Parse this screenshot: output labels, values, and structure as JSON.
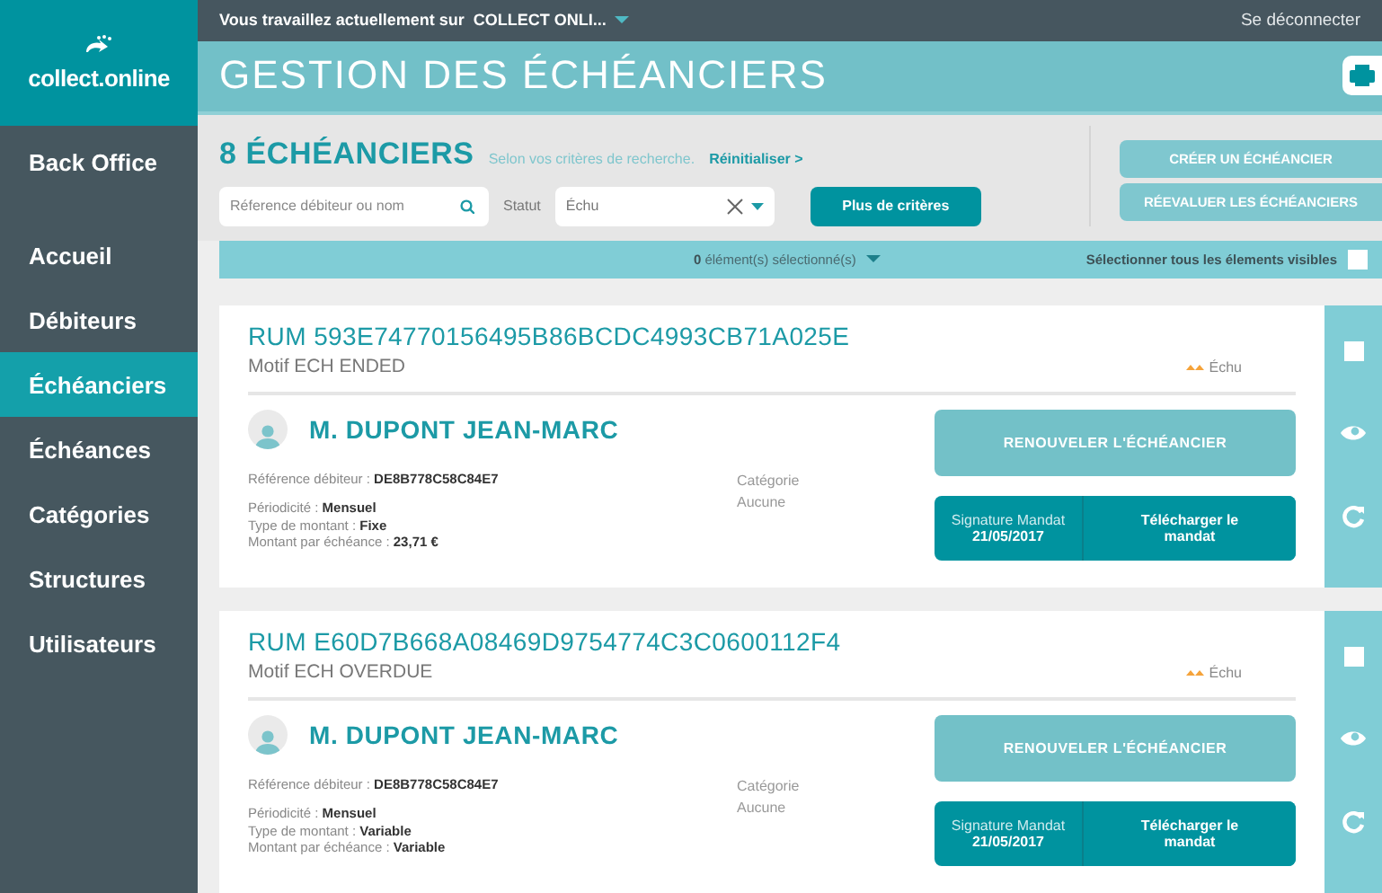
{
  "top_bar": {
    "workspace_label": "Vous travaillez actuellement sur",
    "workspace": "COLLECT ONLI...",
    "logout": "Se déconnecter"
  },
  "logo": {
    "text": "collect.online"
  },
  "sidebar": {
    "items": [
      {
        "label": "Back Office",
        "kind": "heading",
        "selected": false
      },
      {
        "label": "Accueil",
        "kind": "link",
        "selected": false
      },
      {
        "label": "Débiteurs",
        "kind": "link",
        "selected": false
      },
      {
        "label": "Échéanciers",
        "kind": "link",
        "selected": true
      },
      {
        "label": "Échéances",
        "kind": "link",
        "selected": false
      },
      {
        "label": "Catégories",
        "kind": "link",
        "selected": false
      },
      {
        "label": "Structures",
        "kind": "link",
        "selected": false
      },
      {
        "label": "Utilisateurs",
        "kind": "link",
        "selected": false
      }
    ]
  },
  "header": {
    "title": "GESTION DES ÉCHÉANCIERS"
  },
  "filters": {
    "count_title": "8 ÉCHÉANCIERS",
    "criteria_note": "Selon vos critères de recherche.",
    "reset_link": "Réinitialiser >",
    "search": {
      "placeholder": "Réference débiteur ou nom"
    },
    "status_label": "Statut",
    "status_value": "Échu",
    "more_button": "Plus de critères",
    "actions": [
      "CRÉER UN ÉCHÉANCIER",
      "RÉEVALUER LES ÉCHÉANCIERS"
    ]
  },
  "selection_bar": {
    "count": "0",
    "count_text": "élément(s) sélectionné(s)",
    "select_all_label": "Sélectionner tous les élements visibles",
    "checked": false
  },
  "schedules": [
    {
      "rum": "RUM 593E74770156495B86BCDC4993CB71A025E",
      "motif": "Motif ECH ENDED",
      "status": "Échu",
      "debtor": "M. DUPONT JEAN-MARC",
      "reference_label": "Référence débiteur :",
      "reference": "DE8B778C58C84E7",
      "periodicity_label": "Périodicité :",
      "periodicity": "Mensuel",
      "amount_type_label": "Type de montant :",
      "amount_type": "Fixe",
      "amount_label": "Montant par échéance :",
      "amount": "23,71 €",
      "category_label": "Catégorie",
      "category": "Aucune",
      "renew_button": "RENOUVELER L'ÉCHÉANCIER",
      "mandate_label": "Signature Mandat",
      "mandate_date": "21/05/2017",
      "download_button": "Télécharger le mandat",
      "checked": false
    },
    {
      "rum": "RUM E60D7B668A08469D9754774C3C0600112F4",
      "motif": "Motif ECH OVERDUE",
      "status": "Échu",
      "debtor": "M. DUPONT JEAN-MARC",
      "reference_label": "Référence débiteur :",
      "reference": "DE8B778C58C84E7",
      "periodicity_label": "Périodicité :",
      "periodicity": "Mensuel",
      "amount_type_label": "Type de montant :",
      "amount_type": "Variable",
      "amount_label": "Montant par échéance :",
      "amount": "Variable",
      "category_label": "Catégorie",
      "category": "Aucune",
      "renew_button": "RENOUVELER L'ÉCHÉANCIER",
      "mandate_label": "Signature Mandat",
      "mandate_date": "21/05/2017",
      "download_button": "Télécharger le mandat",
      "checked": false
    }
  ]
}
